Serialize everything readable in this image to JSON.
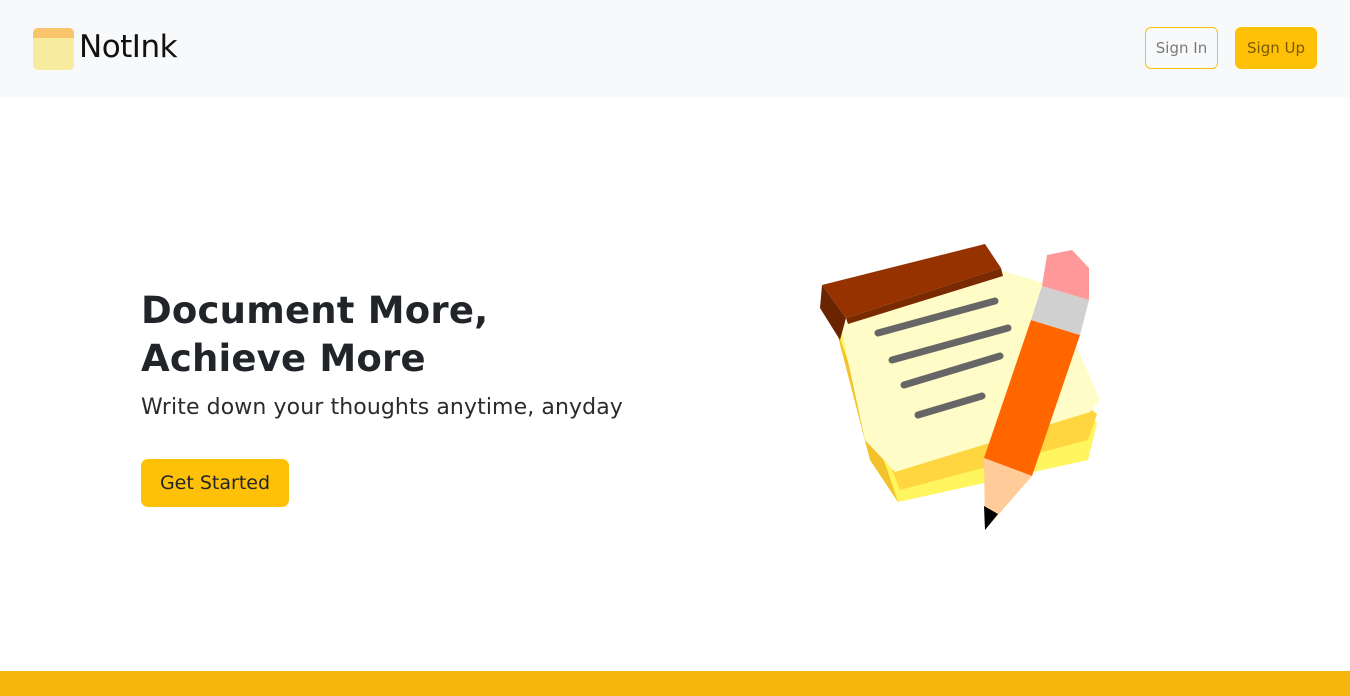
{
  "navbar": {
    "brand_name": "NotInk",
    "brand_icon": "notepad-icon",
    "signin_label": "Sign In",
    "signup_label": "Sign Up"
  },
  "hero": {
    "title_line1": "Document More,",
    "title_line2": "Achieve More",
    "subtitle": "Write down your thoughts anytime, anyday",
    "cta_label": "Get Started",
    "illustration": "notepad-and-pencil-icon"
  },
  "colors": {
    "accent": "#ffc107",
    "navbar_bg": "#f8f9fa",
    "footer_bar": "#f5b70b",
    "text_dark": "#212529"
  }
}
